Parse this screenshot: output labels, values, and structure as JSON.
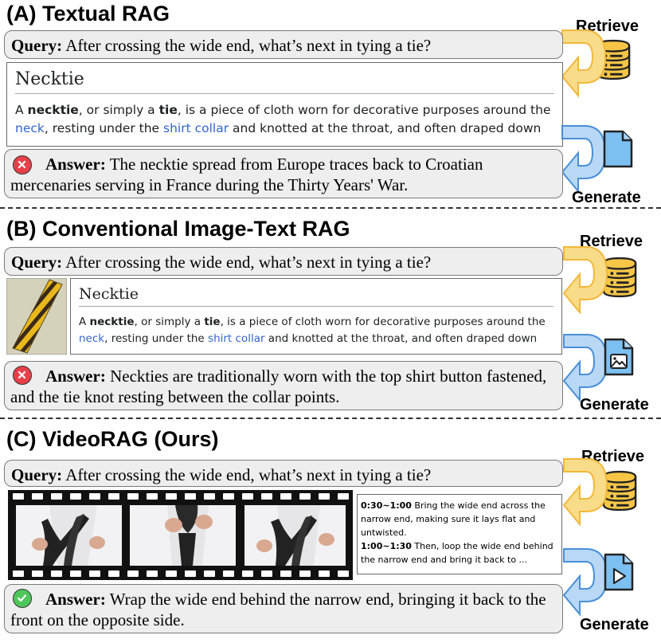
{
  "side_labels": {
    "retrieve": "Retrieve",
    "generate": "Generate"
  },
  "colors": {
    "retrieve_arrow": "#f7c646",
    "generate_arrow": "#5a9fe0",
    "database": "#f7c646",
    "document": "#7cc0f2",
    "error_badge": "#e8404a",
    "success_badge": "#4ec65a",
    "wiki_link": "#3366cc"
  },
  "icons": {
    "retrieve": "database-icon",
    "a_generate": "document-icon",
    "b_generate": "image-file-icon",
    "c_generate": "video-file-icon",
    "wrong": "x-circle-icon",
    "correct": "check-circle-icon"
  },
  "sections": {
    "a": {
      "title": "(A) Textual RAG",
      "query_label": "Query:",
      "query_text": " After crossing the wide end, what’s next in tying a tie?",
      "wiki": {
        "title": "Necktie",
        "line1": [
          "A ",
          "necktie",
          ", or simply a ",
          "tie",
          ", is a piece of cloth worn for decorative purposes around the"
        ],
        "line2": [
          "neck",
          ", resting under the ",
          "shirt collar",
          " and knotted at the throat, and often draped down"
        ]
      },
      "answer_label": "Answer:",
      "answer_text": " The necktie spread from Europe traces back to Croatian mercenaries serving in France during the Thirty Years' War."
    },
    "b": {
      "title": "(B) Conventional Image-Text RAG",
      "query_label": "Query:",
      "query_text": " After crossing the wide end, what’s next in tying a tie?",
      "wiki": {
        "title": "Necktie",
        "line1": [
          "A ",
          "necktie",
          ", or simply a ",
          "tie",
          ", is a piece of cloth worn for decorative purposes around the"
        ],
        "line2": [
          "neck",
          ", resting under the ",
          "shirt collar",
          " and knotted at the throat, and often draped down"
        ]
      },
      "answer_label": "Answer:",
      "answer_text": " Neckties are traditionally worn with the top shirt button fastened, and the tie knot resting between the collar points."
    },
    "c": {
      "title": "(C) VideoRAG (Ours)",
      "query_label": "Query:",
      "query_text": " After crossing the wide end, what’s next in tying a tie?",
      "transcript": [
        {
          "time": "0:30~1:00",
          "text": " Bring the wide end across the narrow end, making sure it lays flat and untwisted."
        },
        {
          "time": "1:00~1:30",
          "text": " Then, loop the wide end behind the narrow end and bring it back to ..."
        }
      ],
      "answer_label": "Answer:",
      "answer_text": " Wrap the wide end behind the narrow end, bringing it back to the front on the opposite side."
    }
  }
}
